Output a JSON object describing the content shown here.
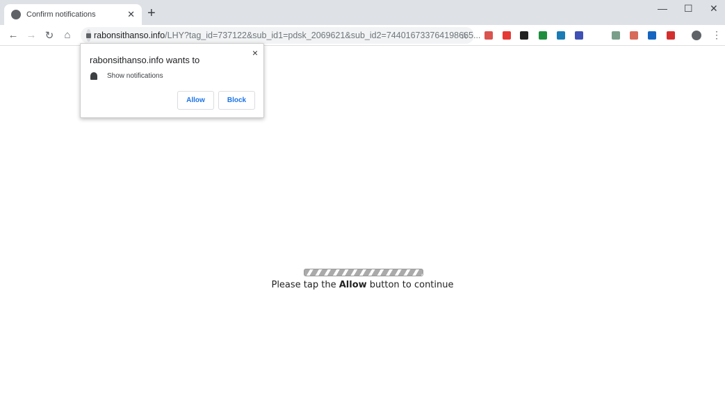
{
  "tab": {
    "title": "Confirm notifications",
    "icon": "globe-icon"
  },
  "window": {
    "minimize": "—",
    "maximize": "☐",
    "close": "✕"
  },
  "omnibox": {
    "domain": "rabonsithanso.info",
    "path": "/LHY?tag_id=737122&sub_id1=pdsk_2069621&sub_id2=744016733764198665..."
  },
  "extensions": [
    {
      "color": "#d9534f"
    },
    {
      "color": "#e53935"
    },
    {
      "color": "#222222"
    },
    {
      "color": "#1e8e3e"
    },
    {
      "color": "#1a7bb5"
    },
    {
      "color": "#3f51b5"
    },
    {
      "color": "#7a9e8a"
    },
    {
      "color": "#d86a5a"
    },
    {
      "color": "#1565c0"
    },
    {
      "color": "#d32f2f"
    }
  ],
  "popup": {
    "heading": "rabonsithanso.info wants to",
    "permission": "Show notifications",
    "allow": "Allow",
    "block": "Block",
    "close": "×"
  },
  "page": {
    "progress_percent": 100,
    "msg_before": "Please tap the ",
    "msg_bold": "Allow",
    "msg_after": " button to continue"
  }
}
